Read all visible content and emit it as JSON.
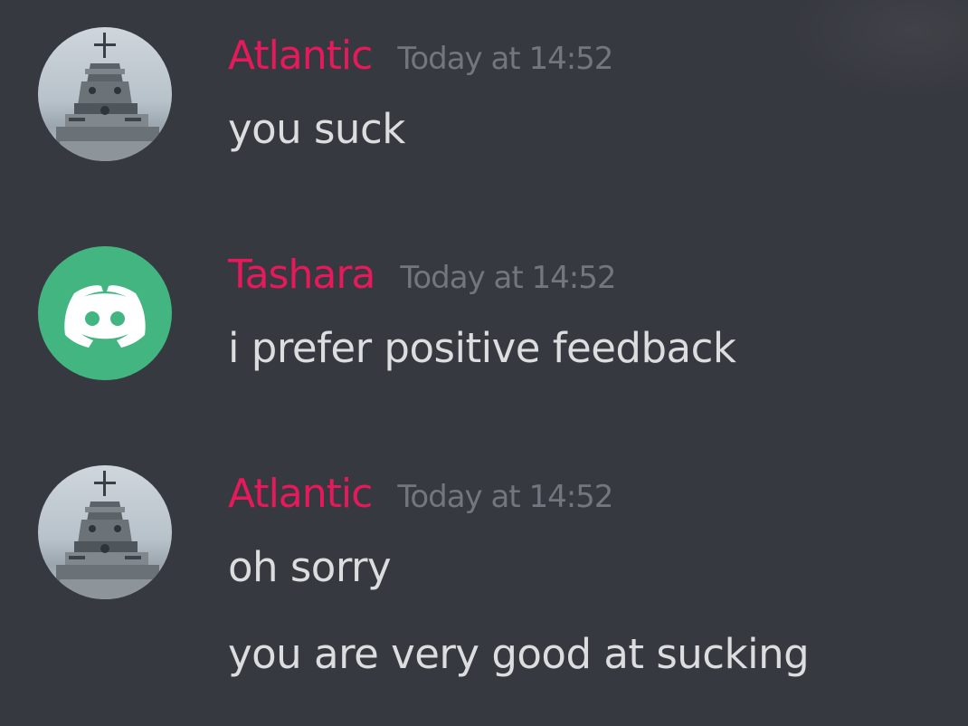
{
  "messages": [
    {
      "username": "Atlantic",
      "timestamp": "Today at 14:52",
      "avatar_icon": "battleship-avatar",
      "lines": [
        "you suck"
      ]
    },
    {
      "username": "Tashara",
      "timestamp": "Today at 14:52",
      "avatar_icon": "discord-logo-avatar",
      "lines": [
        "i prefer positive feedback"
      ]
    },
    {
      "username": "Atlantic",
      "timestamp": "Today at 14:52",
      "avatar_icon": "battleship-avatar",
      "lines": [
        "oh sorry",
        "you are very good at sucking"
      ]
    }
  ],
  "colors": {
    "background": "#36393f",
    "username": "#e6195a",
    "timestamp": "#72767d",
    "text": "#dcddde",
    "discord_avatar": "#43b581"
  }
}
